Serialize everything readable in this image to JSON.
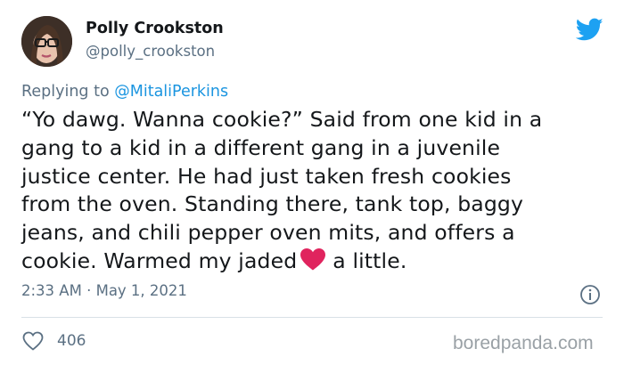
{
  "author": {
    "name": "Polly Crookston",
    "handle": "@polly_crookston"
  },
  "reply": {
    "prefix": "Replying to",
    "mention": "@MitaliPerkins"
  },
  "tweet": {
    "lines": [
      "“Yo dawg. Wanna cookie?” Said from one kid in a",
      "gang to a kid in a different gang in a juvenile",
      "justice center. He had just taken fresh cookies",
      "from the oven. Standing there, tank top, baggy",
      "jeans, and chili pepper oven mits, and offers a",
      "cookie. Warmed my jaded",
      "a little."
    ],
    "emoji": "red-heart"
  },
  "meta": {
    "time": "2:33 AM",
    "separator": "·",
    "date": "May 1, 2021"
  },
  "actions": {
    "like_count": "406"
  },
  "watermark": "boredpanda.com",
  "colors": {
    "link": "#1b95e0",
    "secondary": "#5b7083",
    "divider": "#d9e1e6",
    "heart": "#e0245e",
    "twitter": "#1da1f2"
  },
  "icons": {
    "brand": "twitter-bird-icon",
    "info": "info-icon",
    "like": "heart-outline-icon"
  }
}
